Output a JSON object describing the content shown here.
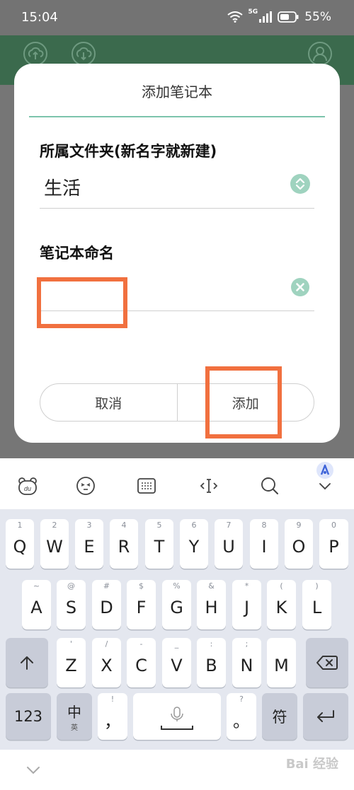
{
  "status_bar": {
    "time": "15:04",
    "network": "5G",
    "battery": "55%"
  },
  "dialog": {
    "title": "添加笔记本",
    "folder_label": "所属文件夹(新名字就新建)",
    "folder_value": "生活",
    "name_label": "笔记本命名",
    "name_value": "",
    "cancel_label": "取消",
    "add_label": "添加"
  },
  "keyboard": {
    "row1": [
      {
        "hint": "1",
        "key": "Q"
      },
      {
        "hint": "2",
        "key": "W"
      },
      {
        "hint": "3",
        "key": "E"
      },
      {
        "hint": "4",
        "key": "R"
      },
      {
        "hint": "5",
        "key": "T"
      },
      {
        "hint": "6",
        "key": "Y"
      },
      {
        "hint": "7",
        "key": "U"
      },
      {
        "hint": "8",
        "key": "I"
      },
      {
        "hint": "9",
        "key": "O"
      },
      {
        "hint": "0",
        "key": "P"
      }
    ],
    "row2": [
      {
        "hint": "~",
        "key": "A"
      },
      {
        "hint": "@",
        "key": "S"
      },
      {
        "hint": "#",
        "key": "D"
      },
      {
        "hint": "$",
        "key": "F"
      },
      {
        "hint": "%",
        "key": "G"
      },
      {
        "hint": "&",
        "key": "H"
      },
      {
        "hint": "*",
        "key": "J"
      },
      {
        "hint": "(",
        "key": "K"
      },
      {
        "hint": ")",
        "key": "L"
      }
    ],
    "row3": [
      {
        "hint": "'",
        "key": "Z"
      },
      {
        "hint": "/",
        "key": "X"
      },
      {
        "hint": "-",
        "key": "C"
      },
      {
        "hint": "_",
        "key": "V"
      },
      {
        "hint": ":",
        "key": "B"
      },
      {
        "hint": ";",
        "key": "N"
      },
      {
        "hint": "",
        "key": "M"
      }
    ],
    "numbers_key": "123",
    "chinese_key": "中",
    "chinese_sub": "英",
    "comma_hint": "!",
    "comma_key": "，",
    "period_hint": "?",
    "period_key": "。",
    "symbol_key": "符"
  },
  "watermark": "Bai 经验",
  "colors": {
    "accent": "#7cc4ac",
    "highlight": "#f1703f",
    "header": "#3b6a4d"
  }
}
